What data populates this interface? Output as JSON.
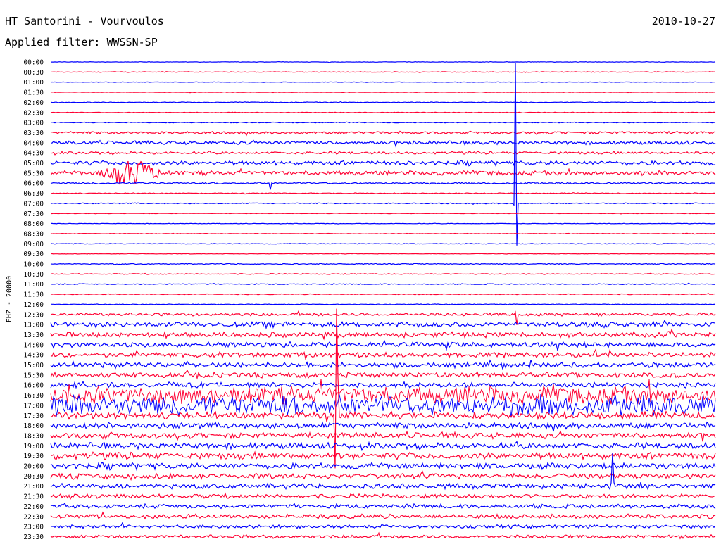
{
  "header": {
    "station": "HT Santorini - Vourvoulos",
    "date": "2010-10-27",
    "filter": "Applied filter: WWSSN-SP"
  },
  "colors": {
    "blue": "#0000ff",
    "red": "#ff0033",
    "text": "#000000",
    "background": "#ffffff"
  },
  "chart_data": {
    "type": "helicorder",
    "channel_label": "EHZ - 20000",
    "trace_colors": [
      "blue",
      "red"
    ],
    "time_labels": [
      "00:00",
      "00:30",
      "01:00",
      "01:30",
      "02:00",
      "02:30",
      "03:00",
      "03:30",
      "04:00",
      "04:30",
      "05:00",
      "05:30",
      "06:00",
      "06:30",
      "07:00",
      "07:30",
      "08:00",
      "08:30",
      "09:00",
      "09:30",
      "10:00",
      "10:30",
      "11:00",
      "11:30",
      "12:00",
      "12:30",
      "13:00",
      "13:30",
      "14:00",
      "14:30",
      "15:00",
      "15:30",
      "16:00",
      "16:30",
      "17:00",
      "17:30",
      "18:00",
      "18:30",
      "19:00",
      "19:30",
      "20:00",
      "20:30",
      "21:00",
      "21:30",
      "22:00",
      "22:30",
      "23:00",
      "23:30"
    ],
    "noise_level": [
      0.3,
      0.4,
      0.3,
      0.3,
      0.4,
      0.4,
      0.5,
      1.5,
      2,
      1.5,
      2.5,
      2.5,
      1,
      0.5,
      0.6,
      0.3,
      0.3,
      0.4,
      0.4,
      0.3,
      0.6,
      0.6,
      0.6,
      0.5,
      0.4,
      1.8,
      3,
      3,
      3,
      3,
      3,
      3,
      3,
      10,
      12,
      4,
      3.5,
      3.5,
      3.5,
      4,
      3.5,
      3,
      3,
      2.5,
      2.5,
      2.5,
      2,
      2
    ],
    "events": [
      {
        "line": "05:30",
        "position": 0.12,
        "amplitude": 28,
        "duration": 0.05
      },
      {
        "line": "06:00",
        "position": 0.33,
        "amplitude": 18,
        "duration": 0.003
      },
      {
        "line": "07:00",
        "position": 0.7,
        "amplitude": 300,
        "duration": 0.003
      },
      {
        "line": "12:30",
        "position": 0.7,
        "amplitude": 40,
        "duration": 0.003
      },
      {
        "line": "17:30",
        "position": 0.43,
        "amplitude": 200,
        "duration": 0.004
      },
      {
        "line": "21:00",
        "position": 0.845,
        "amplitude": 80,
        "duration": 0.003
      }
    ]
  }
}
